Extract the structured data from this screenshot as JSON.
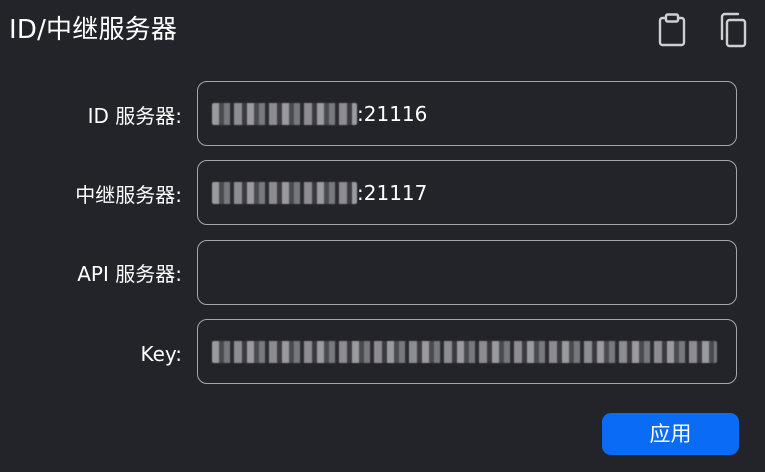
{
  "dialog": {
    "title": "ID/中继服务器"
  },
  "toolbar": {
    "paste_icon": "clipboard-icon",
    "copy_icon": "copy-icon"
  },
  "fields": {
    "id_server": {
      "label": "ID 服务器:",
      "value_suffix": ":21116"
    },
    "relay_server": {
      "label": "中继服务器:",
      "value_suffix": ":21117"
    },
    "api_server": {
      "label": "API 服务器:",
      "value": ""
    },
    "key": {
      "label": "Key:",
      "value": ""
    }
  },
  "actions": {
    "apply_label": "应用"
  },
  "colors": {
    "background": "#232429",
    "border": "#a6a6aa",
    "accent": "#0a6cf5"
  }
}
